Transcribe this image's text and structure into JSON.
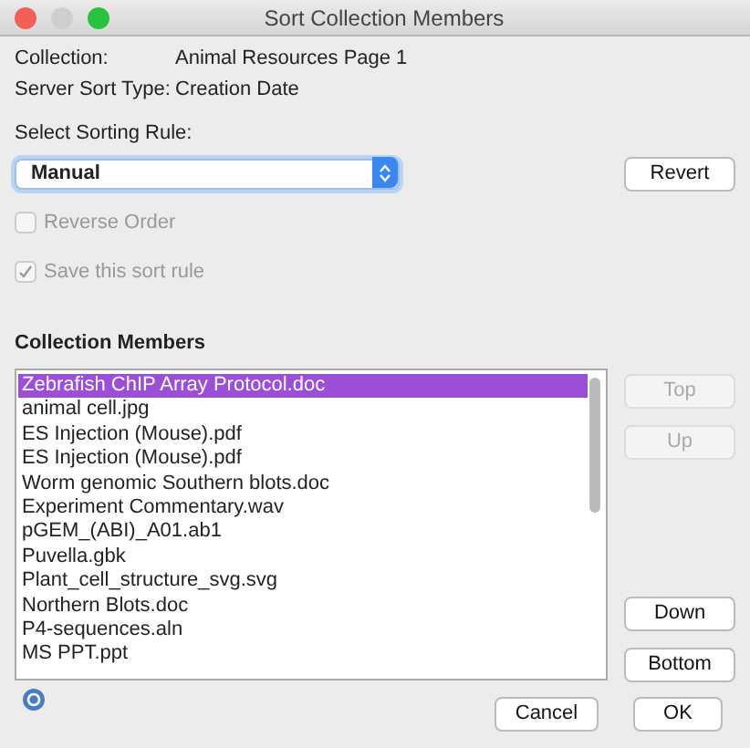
{
  "window": {
    "title": "Sort Collection Members"
  },
  "info": [
    {
      "label": "Collection:",
      "value": "Animal Resources Page 1"
    },
    {
      "label": "Server Sort Type:",
      "value": "Creation Date"
    }
  ],
  "sorting_rule": {
    "label": "Select Sorting Rule:",
    "value": "Manual",
    "revert_button": "Revert"
  },
  "options": [
    {
      "label": "Reverse Order",
      "checked": false,
      "disabled": true
    },
    {
      "label": "Save this sort rule",
      "checked": true,
      "disabled": true
    }
  ],
  "members": {
    "heading": "Collection Members",
    "items": [
      {
        "name": "Zebrafish ChIP Array Protocol.doc",
        "selected": true
      },
      {
        "name": "animal cell.jpg",
        "selected": false
      },
      {
        "name": "ES Injection (Mouse).pdf",
        "selected": false
      },
      {
        "name": "ES Injection (Mouse).pdf",
        "selected": false
      },
      {
        "name": "Worm genomic Southern blots.doc",
        "selected": false
      },
      {
        "name": "Experiment Commentary.wav",
        "selected": false
      },
      {
        "name": "pGEM_(ABI)_A01.ab1",
        "selected": false
      },
      {
        "name": "Puvella.gbk",
        "selected": false
      },
      {
        "name": "Plant_cell_structure_svg.svg",
        "selected": false
      },
      {
        "name": "Northern Blots.doc",
        "selected": false
      },
      {
        "name": "P4-sequences.aln",
        "selected": false
      },
      {
        "name": "MS PPT.ppt",
        "selected": false
      }
    ]
  },
  "move_buttons": [
    {
      "label": "Top",
      "disabled": true
    },
    {
      "label": "Up",
      "disabled": true
    },
    {
      "label": "Down",
      "disabled": false
    },
    {
      "label": "Bottom",
      "disabled": false
    }
  ],
  "footer_buttons": [
    "Cancel",
    "OK"
  ]
}
